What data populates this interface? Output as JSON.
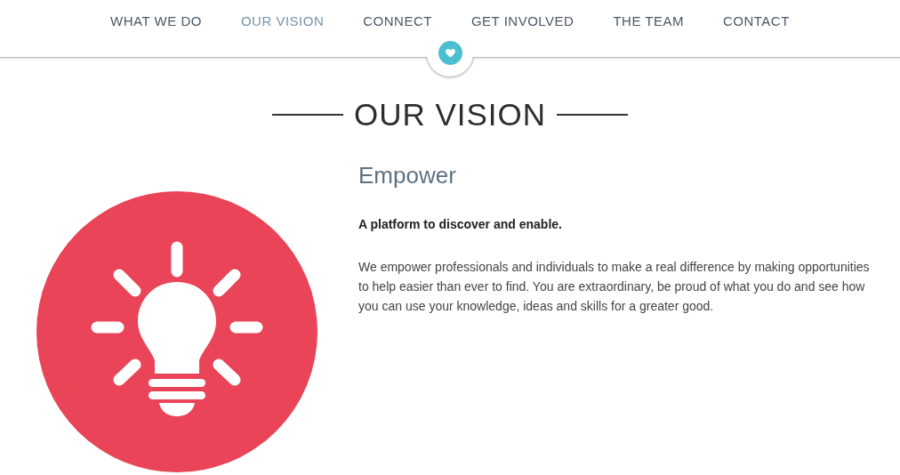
{
  "nav": [
    {
      "label": "WHAT WE DO",
      "selected": false
    },
    {
      "label": "OUR VISION",
      "selected": true
    },
    {
      "label": "CONNECT",
      "selected": false
    },
    {
      "label": "GET INVOLVED",
      "selected": false
    },
    {
      "label": "THE TEAM",
      "selected": false
    },
    {
      "label": "CONTACT",
      "selected": false
    }
  ],
  "section_title": "OUR VISION",
  "feature": {
    "heading": "Empower",
    "tagline": "A platform to discover and enable.",
    "body": "We empower professionals and individuals to make a real difference by making opportunities to help easier than ever to find. You are extraordinary, be proud of what you do and see how you can use your knowledge, ideas and skills for a greater good."
  }
}
